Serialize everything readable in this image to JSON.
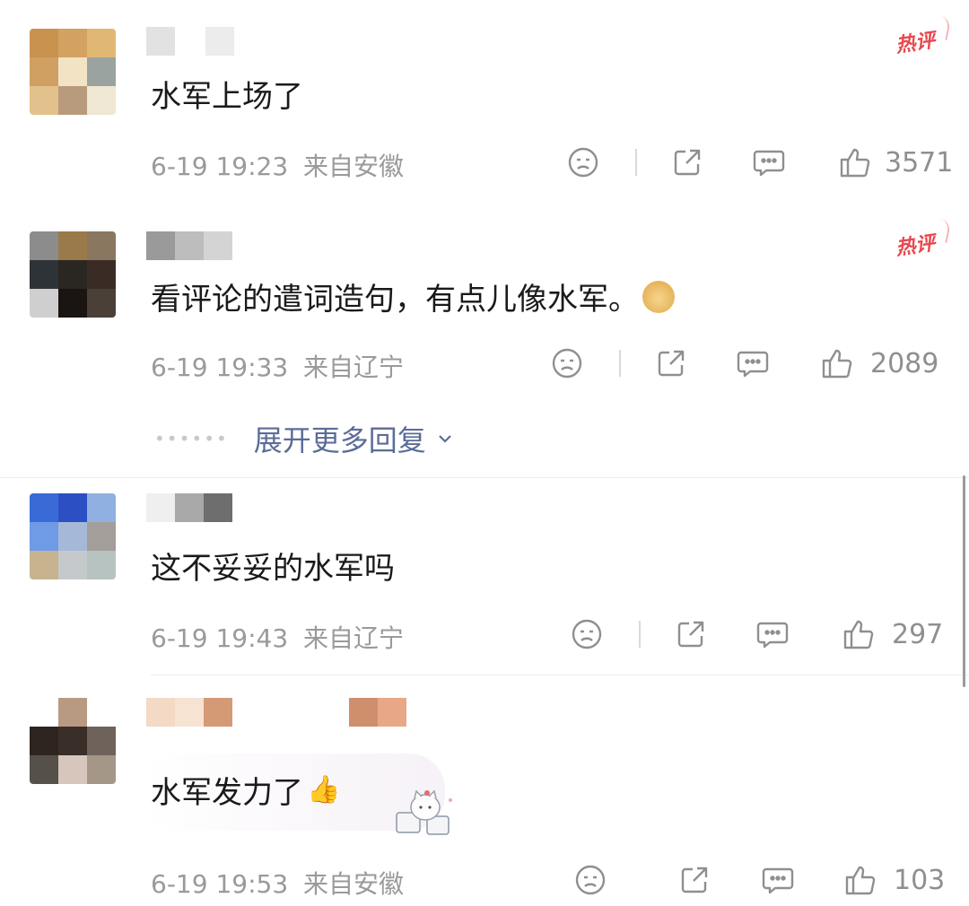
{
  "comments": [
    {
      "text": "水军上场了",
      "time": "6-19 19:23",
      "location": "来自安徽",
      "likes": "3571",
      "badge": "热评",
      "avatar_colors": [
        "#c9924f",
        "#d3a160",
        "#e0b874",
        "#cfa062",
        "#f3e3c5",
        "#9aa3a0",
        "#e3c18c",
        "#b89b7d",
        "#efe7d3"
      ]
    },
    {
      "text": "看评论的遣词造句，有点儿像水军。",
      "time": "6-19 19:33",
      "location": "来自辽宁",
      "likes": "2089",
      "badge": "热评",
      "avatar_colors": [
        "#8c8c8c",
        "#9a7a4a",
        "#8a7760",
        "#2e3338",
        "#2a2622",
        "#3a2c24",
        "#cfcfcf",
        "#1a1512",
        "#4a4038"
      ]
    },
    {
      "text": "这不妥妥的水军吗",
      "time": "6-19 19:43",
      "location": "来自辽宁",
      "likes": "297",
      "badge": "",
      "avatar_colors": [
        "#3a6ad6",
        "#2d4fc4",
        "#8fb0e0",
        "#6e9ae6",
        "#a6b8d8",
        "#a39e9a",
        "#c7b48e",
        "#c6c9cc",
        "#b7c3c1"
      ]
    },
    {
      "text": "水军发力了",
      "time": "6-19 19:53",
      "location": "来自安徽",
      "likes": "103",
      "badge": "",
      "avatar_colors": [
        "#ffffff",
        "#b89a82",
        "#ffffff",
        "#2f2520",
        "#3a2e28",
        "#6f625a",
        "#55504a",
        "#d6c6bb",
        "#a49787"
      ]
    }
  ],
  "expand_more": "展开更多回复"
}
